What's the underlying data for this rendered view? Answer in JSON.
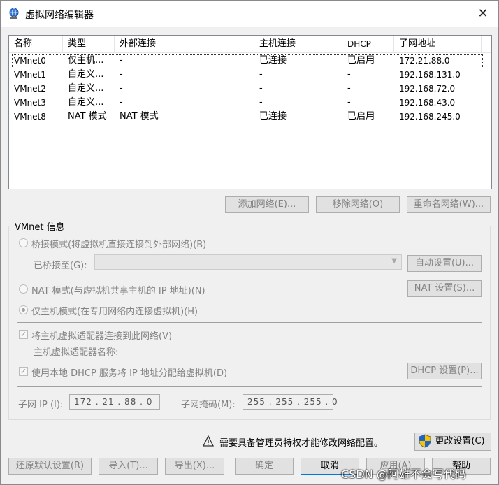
{
  "window": {
    "title": "虚拟网络编辑器",
    "close_glyph": "✕"
  },
  "table": {
    "headers": [
      "名称",
      "类型",
      "外部连接",
      "主机连接",
      "DHCP",
      "子网地址"
    ],
    "rows": [
      [
        "VMnet0",
        "仅主机...",
        "-",
        "已连接",
        "已启用",
        "172.21.88.0"
      ],
      [
        "VMnet1",
        "自定义...",
        "-",
        "-",
        "-",
        "192.168.131.0"
      ],
      [
        "VMnet2",
        "自定义...",
        "-",
        "-",
        "-",
        "192.168.72.0"
      ],
      [
        "VMnet3",
        "自定义...",
        "-",
        "-",
        "-",
        "192.168.43.0"
      ],
      [
        "VMnet8",
        "NAT 模式",
        "NAT 模式",
        "已连接",
        "已启用",
        "192.168.245.0"
      ]
    ]
  },
  "network_buttons": {
    "add": "添加网络(E)...",
    "remove": "移除网络(O)",
    "rename": "重命名网络(W)..."
  },
  "info": {
    "group_title": "VMnet 信息",
    "bridge_radio": "桥接模式(将虚拟机直接连接到外部网络)(B)",
    "bridged_to_label": "已桥接至(G):",
    "auto_settings": "自动设置(U)...",
    "nat_radio": "NAT 模式(与虚拟机共享主机的 IP 地址)(N)",
    "nat_settings": "NAT 设置(S)...",
    "hostonly_radio": "仅主机模式(在专用网络内连接虚拟机)(H)",
    "connect_adapter": "将主机虚拟适配器连接到此网络(V)",
    "adapter_name_label": "主机虚拟适配器名称:",
    "dhcp_check": "使用本地 DHCP 服务将 IP 地址分配给虚拟机(D)",
    "dhcp_settings": "DHCP 设置(P)...",
    "subnet_ip_label": "子网 IP (I):",
    "subnet_ip_value": "172 . 21 . 88 . 0",
    "subnet_mask_label": "子网掩码(M):",
    "subnet_mask_value": "255 . 255 . 255 . 0"
  },
  "admin": {
    "notice": "需要具备管理员特权才能修改网络配置。",
    "change_settings": "更改设置(C)"
  },
  "footer": {
    "restore": "还原默认设置(R)",
    "import": "导入(T)...",
    "export": "导出(X)...",
    "ok": "确定",
    "cancel": "取消",
    "apply": "应用(A)",
    "help": "帮助"
  },
  "watermark": "CSDN @阿雄不会写代码",
  "colors": {
    "accent": "#0078d7",
    "disabled_text": "#838383"
  }
}
